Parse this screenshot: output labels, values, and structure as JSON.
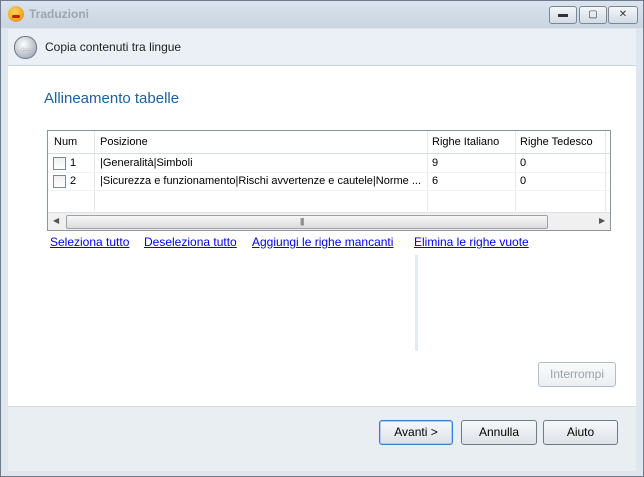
{
  "window": {
    "title": "Traduzioni",
    "controls": {
      "minimize": "▬",
      "maximize": "▢",
      "close": "✕"
    }
  },
  "nav": {
    "back_icon": "back-arrow-icon",
    "title": "Copia contenuti tra lingue"
  },
  "page": {
    "heading": "Allineamento tabelle"
  },
  "table": {
    "columns": [
      "Num",
      "Posizione",
      "Righe Italiano",
      "Righe Tedesco"
    ],
    "rows": [
      {
        "checked": false,
        "num": "1",
        "posizione": "|Generalità|Simboli",
        "righe_italiano": "9",
        "righe_tedesco": "0"
      },
      {
        "checked": false,
        "num": "2",
        "posizione": "|Sicurezza e funzionamento|Rischi avvertenze e cautele|Norme ...",
        "righe_italiano": "6",
        "righe_tedesco": "0"
      }
    ],
    "scroll_grip": "|||"
  },
  "links": {
    "select_all": "Seleziona tutto",
    "deselect_all": "Deseleziona tutto",
    "add_missing": "Aggiungi le righe mancanti",
    "remove_empty": "Elimina le righe vuote"
  },
  "buttons": {
    "interrupt": "Interrompi",
    "next": "Avanti >",
    "cancel": "Annulla",
    "help": "Aiuto"
  },
  "colors": {
    "heading": "#1f5f9a",
    "link": "#0000ee",
    "window_frame": "#dfe6ee"
  }
}
